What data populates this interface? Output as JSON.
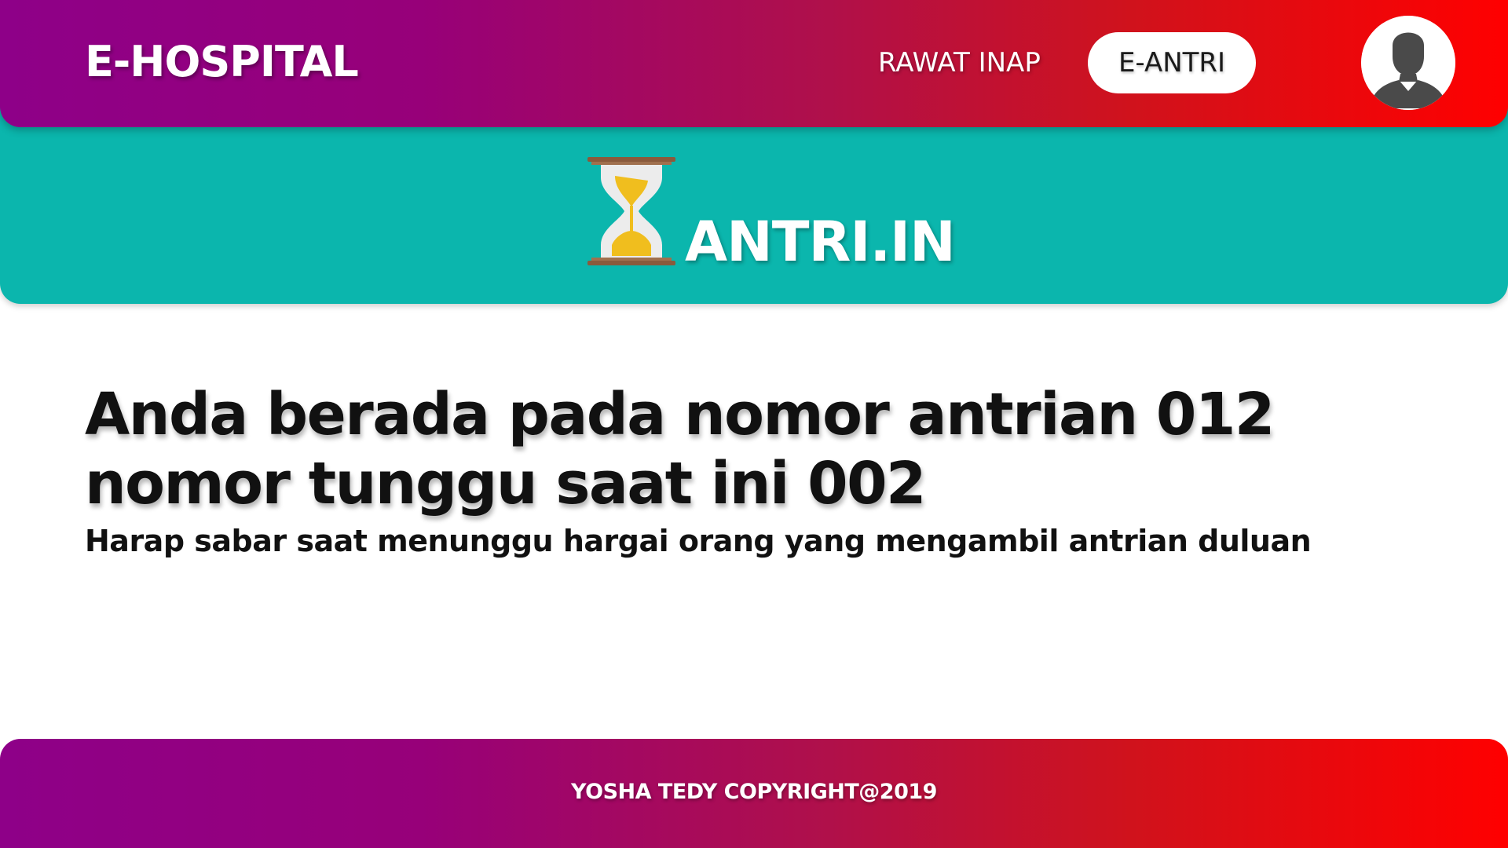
{
  "header": {
    "brand": "E-HOSPITAL",
    "nav": [
      {
        "label": "RAWAT INAP"
      },
      {
        "label": "E-ANTRI"
      }
    ],
    "avatar_icon": "user-avatar-icon"
  },
  "banner": {
    "icon": "hourglass-icon",
    "title": "ANTRI.IN"
  },
  "main": {
    "line1": "Anda berada pada nomor antrian 012",
    "line2": "nomor tunggu saat ini 002",
    "note": "Harap sabar saat menunggu hargai orang yang mengambil antrian duluan"
  },
  "footer": {
    "copyright": "YOSHA TEDY COPYRIGHT@2019"
  },
  "colors": {
    "gradient_start": "#8e0088",
    "gradient_end": "#ff0000",
    "banner": "#0bb6ad",
    "sand": "#f0be1e"
  }
}
